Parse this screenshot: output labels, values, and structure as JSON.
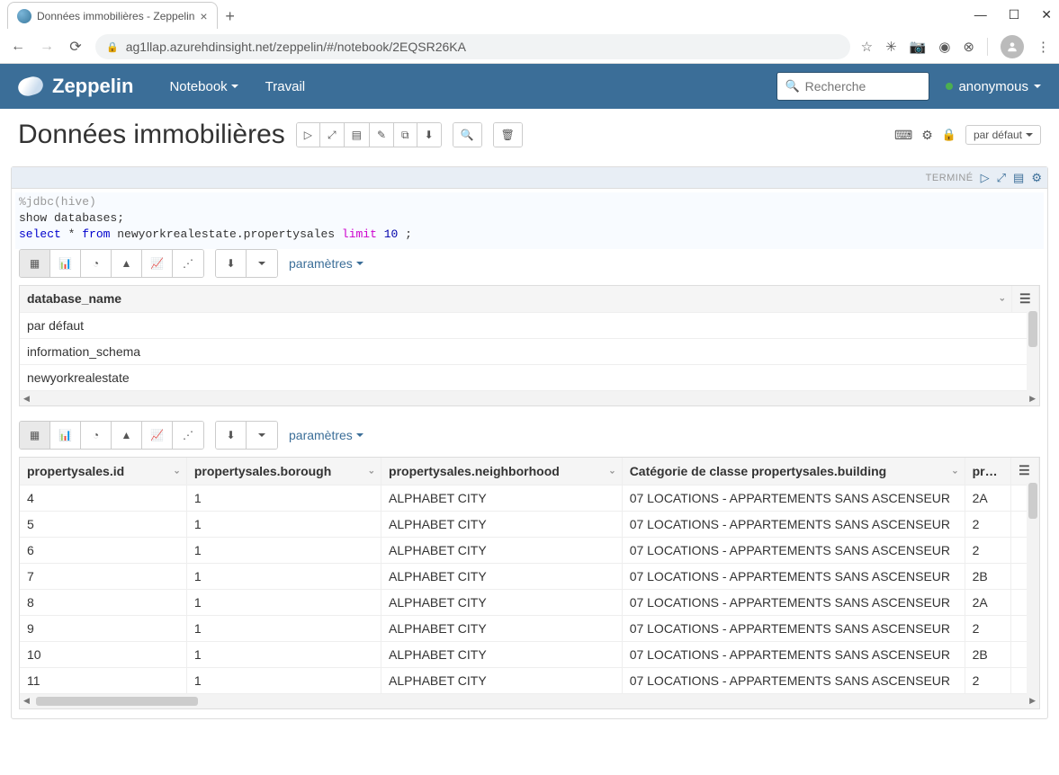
{
  "browser": {
    "tab_title": "Données immobilières - Zeppelin",
    "url": "ag1llap.azurehdinsight.net/zeppelin/#/notebook/2EQSR26KA"
  },
  "topbar": {
    "brand": "Zeppelin",
    "nav": {
      "notebook": "Notebook",
      "travail": "Travail"
    },
    "search_placeholder": "Recherche",
    "user": "anonymous"
  },
  "page": {
    "title": "Données immobilières",
    "default_label": "par défaut"
  },
  "paragraph": {
    "status": "TERMINÉ",
    "code_line1_prefix": "%jdbc(hive)",
    "code_line2": "show databases;",
    "code_line3_select": "select",
    "code_line3_star": " * ",
    "code_line3_from": "from",
    "code_line3_table": " newyorkrealestate.propertysales ",
    "code_line3_limit": "limit",
    "code_line3_num": " 10 ",
    "code_line3_semi": ";",
    "params_label": "paramètres"
  },
  "db_table": {
    "header": "database_name",
    "rows": [
      "par défaut",
      "information_schema",
      "newyorkrealestate"
    ]
  },
  "sales_table": {
    "headers": [
      "propertysales.id",
      "propertysales.borough",
      "propertysales.neighborhood",
      "Catégorie de classe propertysales.building",
      "proper"
    ],
    "rows": [
      [
        "4",
        "1",
        "ALPHABET CITY",
        "07 LOCATIONS - APPARTEMENTS SANS ASCENSEUR",
        "2A"
      ],
      [
        "5",
        "1",
        "ALPHABET CITY",
        "07 LOCATIONS - APPARTEMENTS SANS ASCENSEUR",
        "2"
      ],
      [
        "6",
        "1",
        "ALPHABET CITY",
        "07 LOCATIONS - APPARTEMENTS SANS ASCENSEUR",
        "2"
      ],
      [
        "7",
        "1",
        "ALPHABET CITY",
        "07 LOCATIONS - APPARTEMENTS SANS ASCENSEUR",
        "2B"
      ],
      [
        "8",
        "1",
        "ALPHABET CITY",
        "07 LOCATIONS - APPARTEMENTS SANS ASCENSEUR",
        "2A"
      ],
      [
        "9",
        "1",
        "ALPHABET CITY",
        "07 LOCATIONS - APPARTEMENTS SANS ASCENSEUR",
        "2"
      ],
      [
        "10",
        "1",
        "ALPHABET CITY",
        "07 LOCATIONS - APPARTEMENTS SANS ASCENSEUR",
        "2B"
      ],
      [
        "11",
        "1",
        "ALPHABET CITY",
        "07 LOCATIONS - APPARTEMENTS SANS ASCENSEUR",
        "2"
      ]
    ]
  }
}
